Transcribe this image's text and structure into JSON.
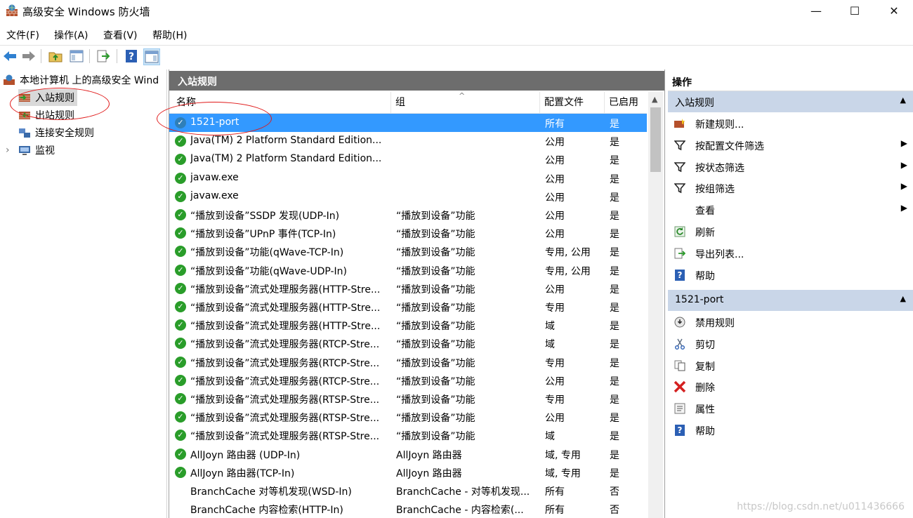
{
  "window": {
    "title": "高级安全 Windows 防火墙",
    "minimize": "—",
    "maximize": "☐",
    "close": "✕"
  },
  "menu": [
    "文件(F)",
    "操作(A)",
    "查看(V)",
    "帮助(H)"
  ],
  "tree": {
    "root": "本地计算机 上的高级安全 Wind",
    "items": [
      "入站规则",
      "出站规则",
      "连接安全规则",
      "监视"
    ],
    "expander": "›"
  },
  "center": {
    "title": "入站规则",
    "columns": [
      "名称",
      "组",
      "配置文件",
      "已启用"
    ],
    "rows": [
      {
        "name": "1521-port",
        "group": "",
        "profile": "所有",
        "enabled": "是",
        "selected": true
      },
      {
        "name": "Java(TM) 2 Platform Standard Edition...",
        "group": "",
        "profile": "公用",
        "enabled": "是"
      },
      {
        "name": "Java(TM) 2 Platform Standard Edition...",
        "group": "",
        "profile": "公用",
        "enabled": "是"
      },
      {
        "name": "javaw.exe",
        "group": "",
        "profile": "公用",
        "enabled": "是"
      },
      {
        "name": "javaw.exe",
        "group": "",
        "profile": "公用",
        "enabled": "是"
      },
      {
        "name": "“播放到设备”SSDP 发现(UDP-In)",
        "group": "“播放到设备”功能",
        "profile": "公用",
        "enabled": "是"
      },
      {
        "name": "“播放到设备”UPnP 事件(TCP-In)",
        "group": "“播放到设备”功能",
        "profile": "公用",
        "enabled": "是"
      },
      {
        "name": "“播放到设备”功能(qWave-TCP-In)",
        "group": "“播放到设备”功能",
        "profile": "专用, 公用",
        "enabled": "是"
      },
      {
        "name": "“播放到设备”功能(qWave-UDP-In)",
        "group": "“播放到设备”功能",
        "profile": "专用, 公用",
        "enabled": "是"
      },
      {
        "name": "“播放到设备”流式处理服务器(HTTP-Stre...",
        "group": "“播放到设备”功能",
        "profile": "公用",
        "enabled": "是"
      },
      {
        "name": "“播放到设备”流式处理服务器(HTTP-Stre...",
        "group": "“播放到设备”功能",
        "profile": "专用",
        "enabled": "是"
      },
      {
        "name": "“播放到设备”流式处理服务器(HTTP-Stre...",
        "group": "“播放到设备”功能",
        "profile": "域",
        "enabled": "是"
      },
      {
        "name": "“播放到设备”流式处理服务器(RTCP-Stre...",
        "group": "“播放到设备”功能",
        "profile": "域",
        "enabled": "是"
      },
      {
        "name": "“播放到设备”流式处理服务器(RTCP-Stre...",
        "group": "“播放到设备”功能",
        "profile": "专用",
        "enabled": "是"
      },
      {
        "name": "“播放到设备”流式处理服务器(RTCP-Stre...",
        "group": "“播放到设备”功能",
        "profile": "公用",
        "enabled": "是"
      },
      {
        "name": "“播放到设备”流式处理服务器(RTSP-Stre...",
        "group": "“播放到设备”功能",
        "profile": "专用",
        "enabled": "是"
      },
      {
        "name": "“播放到设备”流式处理服务器(RTSP-Stre...",
        "group": "“播放到设备”功能",
        "profile": "公用",
        "enabled": "是"
      },
      {
        "name": "“播放到设备”流式处理服务器(RTSP-Stre...",
        "group": "“播放到设备”功能",
        "profile": "域",
        "enabled": "是"
      },
      {
        "name": "AllJoyn 路由器 (UDP-In)",
        "group": "AllJoyn 路由器",
        "profile": "域, 专用",
        "enabled": "是"
      },
      {
        "name": "AllJoyn 路由器(TCP-In)",
        "group": "AllJoyn 路由器",
        "profile": "域, 专用",
        "enabled": "是"
      },
      {
        "name": "BranchCache 对等机发现(WSD-In)",
        "group": "BranchCache - 对等机发现...",
        "profile": "所有",
        "enabled": "否",
        "noicon": true
      },
      {
        "name": "BranchCache 内容检索(HTTP-In)",
        "group": "BranchCache - 内容检索(...",
        "profile": "所有",
        "enabled": "否",
        "noicon": true
      }
    ]
  },
  "actions": {
    "title": "操作",
    "section1": {
      "title": "入站规则",
      "items": [
        {
          "label": "新建规则...",
          "icon": "new-rule-icon",
          "submenu": false
        },
        {
          "label": "按配置文件筛选",
          "icon": "filter-icon",
          "submenu": true
        },
        {
          "label": "按状态筛选",
          "icon": "filter-icon",
          "submenu": true
        },
        {
          "label": "按组筛选",
          "icon": "filter-icon",
          "submenu": true
        },
        {
          "label": "查看",
          "icon": "",
          "submenu": true
        },
        {
          "label": "刷新",
          "icon": "refresh-icon",
          "submenu": false
        },
        {
          "label": "导出列表...",
          "icon": "export-icon",
          "submenu": false
        },
        {
          "label": "帮助",
          "icon": "help-icon",
          "submenu": false
        }
      ]
    },
    "section2": {
      "title": "1521-port",
      "items": [
        {
          "label": "禁用规则",
          "icon": "disable-icon"
        },
        {
          "label": "剪切",
          "icon": "cut-icon"
        },
        {
          "label": "复制",
          "icon": "copy-icon"
        },
        {
          "label": "删除",
          "icon": "delete-icon"
        },
        {
          "label": "属性",
          "icon": "properties-icon"
        },
        {
          "label": "帮助",
          "icon": "help-icon"
        }
      ]
    }
  },
  "watermark": "https://blog.csdn.net/u011436666",
  "colors": {
    "selection": "#3399ff",
    "panel_header": "#6d6d6d",
    "section_header": "#c9d6e8",
    "enabled_check": "#2a9d2a",
    "annotation": "#e01818"
  }
}
